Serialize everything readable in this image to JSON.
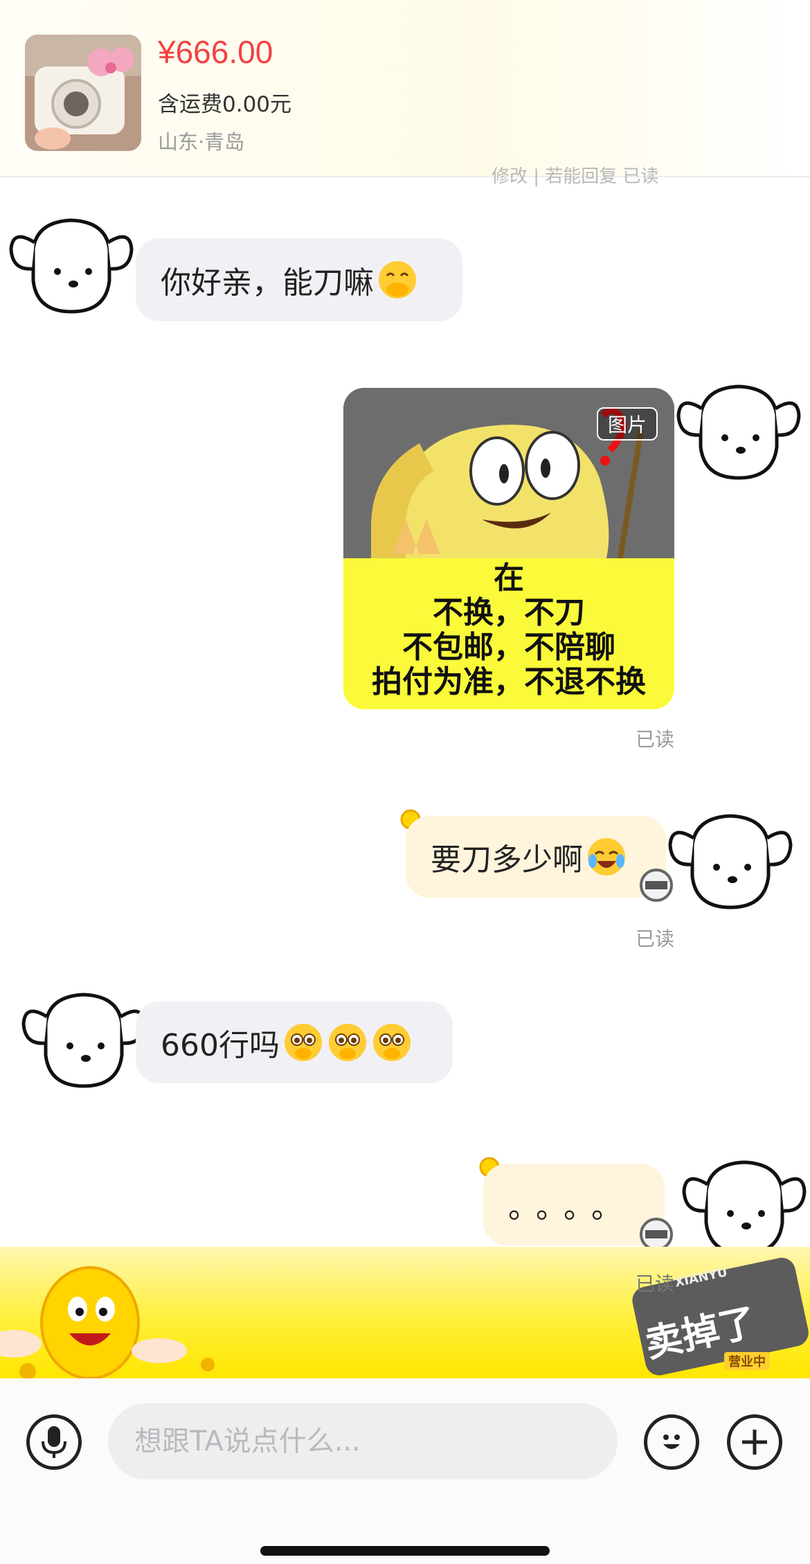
{
  "product": {
    "price": "¥666.00",
    "shipping": "含运费0.00元",
    "location": "山东·青岛",
    "partial_hidden_text": "修改 | 若能回复 已读"
  },
  "messages": [
    {
      "side": "in",
      "text": "你好亲，能刀嘛",
      "emoji": [
        "laugh-cover-mouth-icon"
      ]
    },
    {
      "side": "out",
      "type": "image",
      "image_label": "图片",
      "image_text": [
        "在",
        "不换，不刀",
        "不包邮，不陪聊",
        "拍付为准，不退不换"
      ],
      "status": "已读"
    },
    {
      "side": "out",
      "text": "要刀多少啊",
      "emoji": [
        "crying-laugh-icon"
      ],
      "status": "已读"
    },
    {
      "side": "in",
      "text": "660行吗",
      "emoji": [
        "pleading-icon",
        "pleading-icon",
        "pleading-icon"
      ]
    },
    {
      "side": "out",
      "text": "。。。。",
      "status": "已读"
    }
  ],
  "banner": {
    "stamp_text": "卖掉了",
    "brand_text": "XIANYU",
    "sub_text": "营业中"
  },
  "input": {
    "placeholder": "想跟TA说点什么..."
  },
  "colors": {
    "price": "#f24141",
    "incoming_bubble": "#f1f1f5",
    "outgoing_bubble": "#fff4dc",
    "banner_yellow": "#ffe600"
  }
}
